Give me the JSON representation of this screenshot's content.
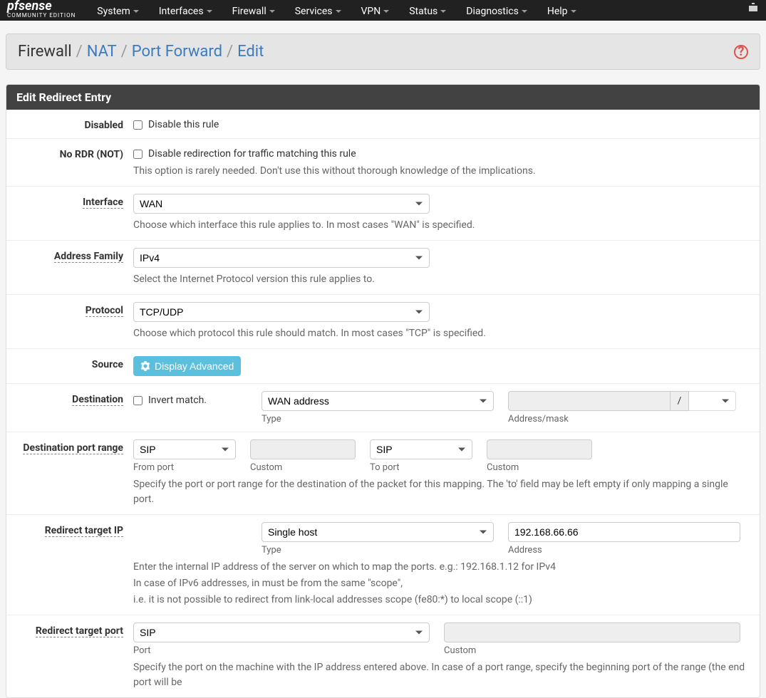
{
  "brand": {
    "name": "pfsense",
    "edition": "COMMUNITY EDITION"
  },
  "nav": {
    "items": [
      "System",
      "Interfaces",
      "Firewall",
      "Services",
      "VPN",
      "Status",
      "Diagnostics",
      "Help"
    ]
  },
  "breadcrumb": {
    "root": "Firewall",
    "nat": "NAT",
    "pf": "Port Forward",
    "edit": "Edit"
  },
  "panel_title": "Edit Redirect Entry",
  "labels": {
    "disabled": "Disabled",
    "no_rdr": "No RDR (NOT)",
    "interface": "Interface",
    "address_family": "Address Family",
    "protocol": "Protocol",
    "source": "Source",
    "destination": "Destination",
    "dest_port_range": "Destination port range",
    "redirect_target_ip": "Redirect target IP",
    "redirect_target_port": "Redirect target port"
  },
  "fields": {
    "disabled_text": "Disable this rule",
    "no_rdr_text": "Disable redirection for traffic matching this rule",
    "no_rdr_help": "This option is rarely needed. Don't use this without thorough knowledge of the implications.",
    "interface_value": "WAN",
    "interface_help": "Choose which interface this rule applies to. In most cases \"WAN\" is specified.",
    "af_value": "IPv4",
    "af_help": "Select the Internet Protocol version this rule applies to.",
    "protocol_value": "TCP/UDP",
    "protocol_help": "Choose which protocol this rule should match. In most cases \"TCP\" is specified.",
    "display_advanced": "Display Advanced",
    "invert_match": "Invert match.",
    "dest_type_value": "WAN address",
    "dest_type_label": "Type",
    "dest_addr_label": "Address/mask",
    "mask_slash": "/",
    "from_port_value": "SIP",
    "from_port_label": "From port",
    "custom_label": "Custom",
    "to_port_value": "SIP",
    "to_port_label": "To port",
    "dest_port_help": "Specify the port or port range for the destination of the packet for this mapping. The 'to' field may be left empty if only mapping a single port.",
    "rti_type_value": "Single host",
    "rti_type_label": "Type",
    "rti_addr_value": "192.168.66.66",
    "rti_addr_label": "Address",
    "rti_help_1": "Enter the internal IP address of the server on which to map the ports. e.g.: 192.168.1.12 for IPv4",
    "rti_help_2": "In case of IPv6 addresses, in must be from the same \"scope\",",
    "rti_help_3": "i.e. it is not possible to redirect from link-local addresses scope (fe80:*) to local scope (::1)",
    "rtp_port_value": "SIP",
    "rtp_port_label": "Port",
    "rtp_custom_label": "Custom",
    "rtp_help": "Specify the port on the machine with the IP address entered above. In case of a port range, specify the beginning port of the range (the end port will be"
  }
}
